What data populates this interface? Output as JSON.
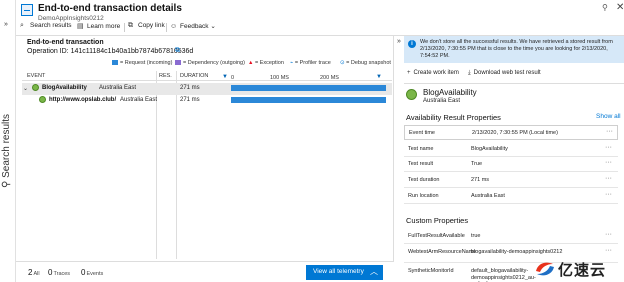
{
  "sidebar": {
    "label": "Search results"
  },
  "header": {
    "title": "End-to-end transaction details",
    "subtitle": "DemoAppInsights0212"
  },
  "toolbar": {
    "search_results": "Search results",
    "learn_more": "Learn more",
    "copy_link": "Copy link",
    "feedback": "Feedback"
  },
  "transaction": {
    "title": "End-to-end transaction",
    "operation_id": "Operation ID: 141c11184c1b40a1bb7874b67810536d"
  },
  "legend": {
    "request": "= Request (incoming)",
    "dependency": "= Dependency (outgoing)",
    "exception": "= Exception",
    "profiler": "= Profiler trace",
    "debug": "= Debug snapshot"
  },
  "table": {
    "col_event": "EVENT",
    "col_res": "RES.",
    "col_duration": "DURATION",
    "scale": [
      "0",
      "100 MS",
      "200 MS"
    ],
    "rows": [
      {
        "name": "BlogAvailability",
        "location": "Australia East",
        "duration": "271 ms",
        "fraction": 1.0
      },
      {
        "name": "http://www.opslab.club/",
        "location": "Australia East",
        "duration": "271 ms",
        "fraction": 1.0
      }
    ]
  },
  "footer": {
    "all_count": "2",
    "all_label": "All",
    "traces_count": "0",
    "traces_label": "Traces",
    "events_count": "0",
    "events_label": "Events",
    "view_all": "View all telemetry"
  },
  "details": {
    "info": "We don't store all the successful results. We have retrieved a stored result from 2/13/2020, 7:30:55 PM that is close to the time you are looking for 2/13/2020, 7:54:52 PM.",
    "create_work_item": "Create work item",
    "download": "Download web test result",
    "resource_name": "BlogAvailability",
    "resource_location": "Australia East",
    "availability_title": "Availability Result Properties",
    "show_all": "Show all",
    "properties": [
      {
        "key": "Event time",
        "value": "2/13/2020, 7:30:55 PM (Local time)"
      },
      {
        "key": "Test name",
        "value": "BlogAvailability"
      },
      {
        "key": "Test result",
        "value": "True"
      },
      {
        "key": "Test duration",
        "value": "271 ms"
      },
      {
        "key": "Run location",
        "value": "Australia East"
      }
    ],
    "custom_title": "Custom Properties",
    "custom": [
      {
        "key": "FullTestResultAvailable",
        "value": "true"
      },
      {
        "key": "WebtestArmResourceName",
        "value": "blogavailability-demoappinsights0212"
      },
      {
        "key": "SyntheticMonitorId",
        "value": "default_blogavailability-demoappinsights0212_au-syd-edge"
      }
    ],
    "more": "···"
  },
  "watermark": {
    "text": "亿速云"
  },
  "colors": {
    "accent": "#0078d4",
    "request": "#2b88d8",
    "dependency": "#8a6bd1",
    "exception": "#e81123",
    "info_bg": "#d6e8f8"
  }
}
